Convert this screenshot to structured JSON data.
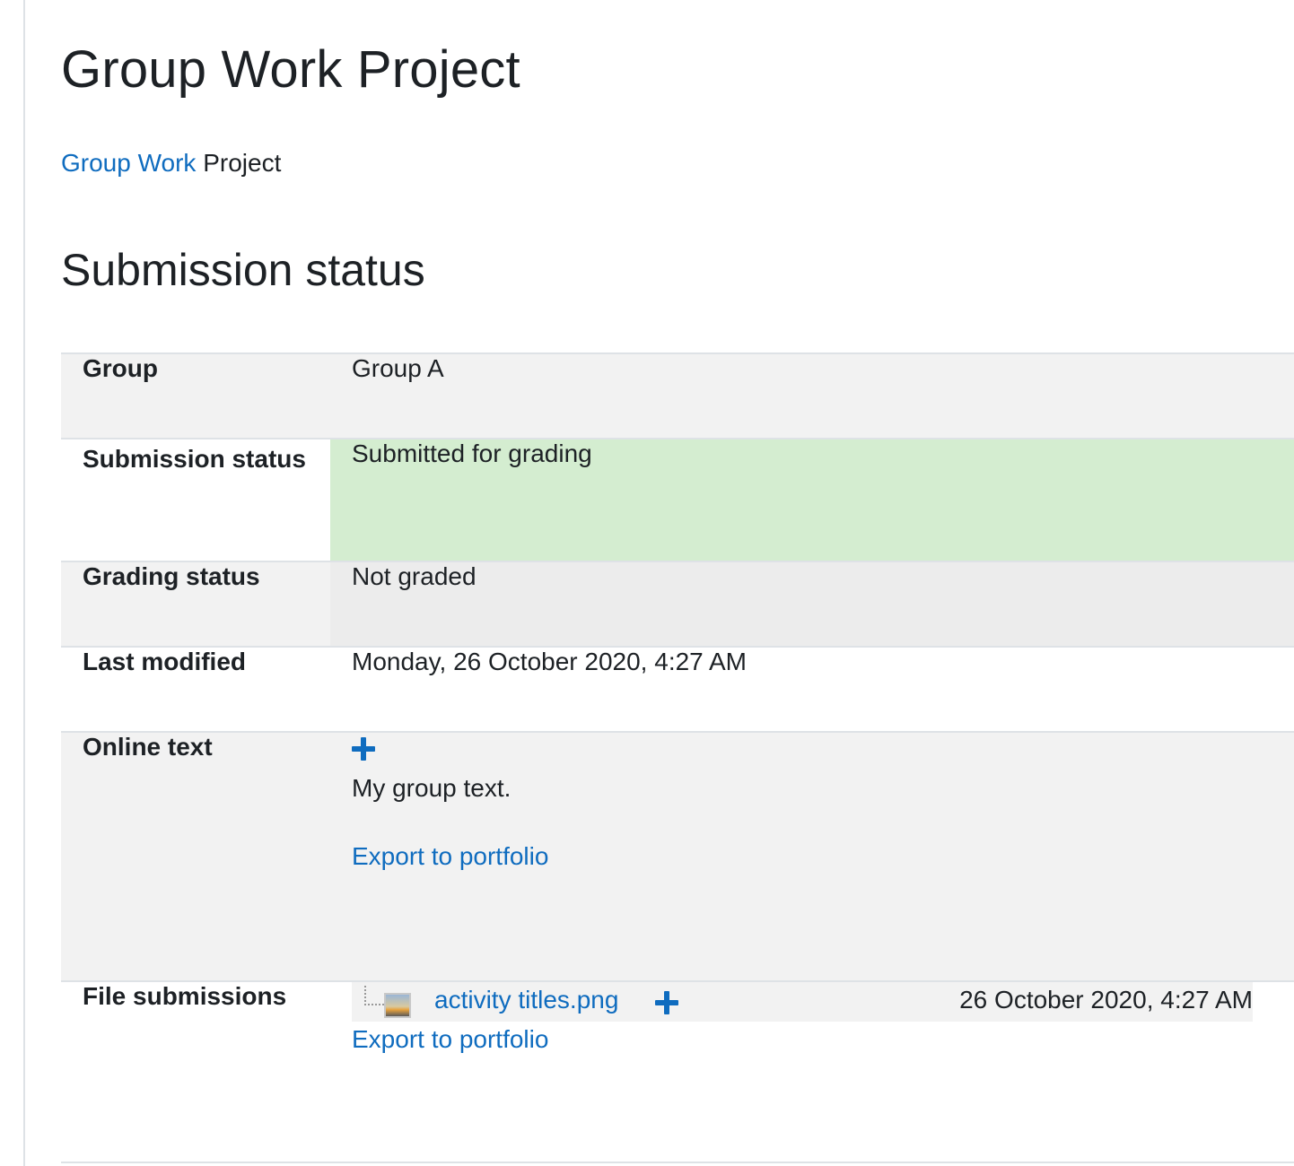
{
  "page": {
    "title": "Group Work Project",
    "intro_link": "Group Work",
    "intro_text": " Project",
    "section_title": "Submission status"
  },
  "status": {
    "group_label": "Group",
    "group_value": "Group A",
    "submission_label": "Submission status",
    "submission_value": "Submitted for grading",
    "grading_label": "Grading status",
    "grading_value": "Not graded",
    "modified_label": "Last modified",
    "modified_value": "Monday, 26 October 2020, 4:27 AM",
    "online_label": "Online text",
    "online_value": "My group text.",
    "online_export": "Export to portfolio",
    "files_label": "File submissions",
    "file_name": "activity titles.png",
    "file_date": "26 October 2020, 4:27 AM",
    "files_export": "Export to portfolio"
  },
  "colors": {
    "link": "#0f6cbf",
    "submitted_bg": "#d4edd0",
    "row_alt_bg": "#f2f2f2"
  },
  "icons": {
    "expand": "plus-icon",
    "file": "image-file-icon"
  }
}
